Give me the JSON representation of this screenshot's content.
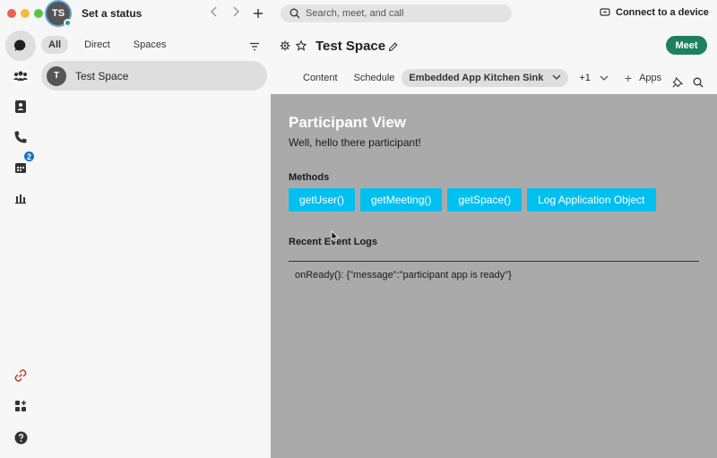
{
  "titlebar": {
    "avatar_initials": "TS",
    "status_label": "Set a status",
    "search_placeholder": "Search, meet, and call",
    "connect_label": "Connect to a device"
  },
  "rail": {
    "items": [
      {
        "icon": "chat-icon",
        "active": true
      },
      {
        "icon": "teams-icon"
      },
      {
        "icon": "contacts-icon"
      },
      {
        "icon": "phone-icon"
      },
      {
        "icon": "calendar-icon",
        "badge": "2"
      },
      {
        "icon": "analytics-icon"
      }
    ],
    "bottom": [
      {
        "icon": "link-icon"
      },
      {
        "icon": "apps-grid-icon"
      },
      {
        "icon": "help-icon"
      }
    ]
  },
  "list": {
    "filters": [
      "All",
      "Direct",
      "Spaces"
    ],
    "spaces": [
      {
        "initial": "T",
        "name": "Test Space"
      }
    ]
  },
  "space": {
    "title": "Test Space",
    "meet_label": "Meet",
    "tabs": [
      "Content",
      "Schedule"
    ],
    "active_tab": "Embedded App Kitchen Sink",
    "more_label": "+1",
    "apps_label": "Apps"
  },
  "app": {
    "title": "Participant View",
    "subtitle": "Well, hello there participant!",
    "methods_label": "Methods",
    "methods": [
      "getUser()",
      "getMeeting()",
      "getSpace()",
      "Log Application Object"
    ],
    "logs_label": "Recent Event Logs",
    "log_line": "onReady(): {\"message\":\"participant app is ready\"}"
  },
  "colors": {
    "accent_green": "#1d805f",
    "method_button": "#00c0f0",
    "badge_blue": "#1170cf",
    "app_background": "#aaaaaa"
  }
}
